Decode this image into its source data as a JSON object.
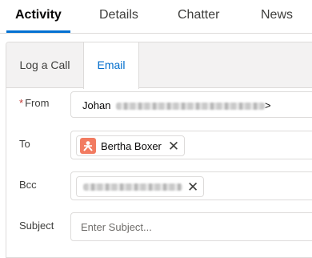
{
  "tabs": [
    {
      "label": "Activity"
    },
    {
      "label": "Details"
    },
    {
      "label": "Chatter"
    },
    {
      "label": "News"
    }
  ],
  "composer": {
    "subtabs": [
      {
        "label": "Log a Call"
      },
      {
        "label": "Email"
      }
    ],
    "from": {
      "required_marker": "*",
      "label": "From",
      "value_prefix": "Johan",
      "value_suffix": ">"
    },
    "to": {
      "label": "To",
      "recipient": "Bertha Boxer",
      "remove_glyph": "✕"
    },
    "bcc": {
      "label": "Bcc",
      "remove_glyph": "✕"
    },
    "subject": {
      "label": "Subject",
      "placeholder": "Enter Subject..."
    }
  },
  "colors": {
    "accent": "#0070d2",
    "link": "#006dcc",
    "required": "#c23934",
    "contact_icon": "#f27b61"
  }
}
